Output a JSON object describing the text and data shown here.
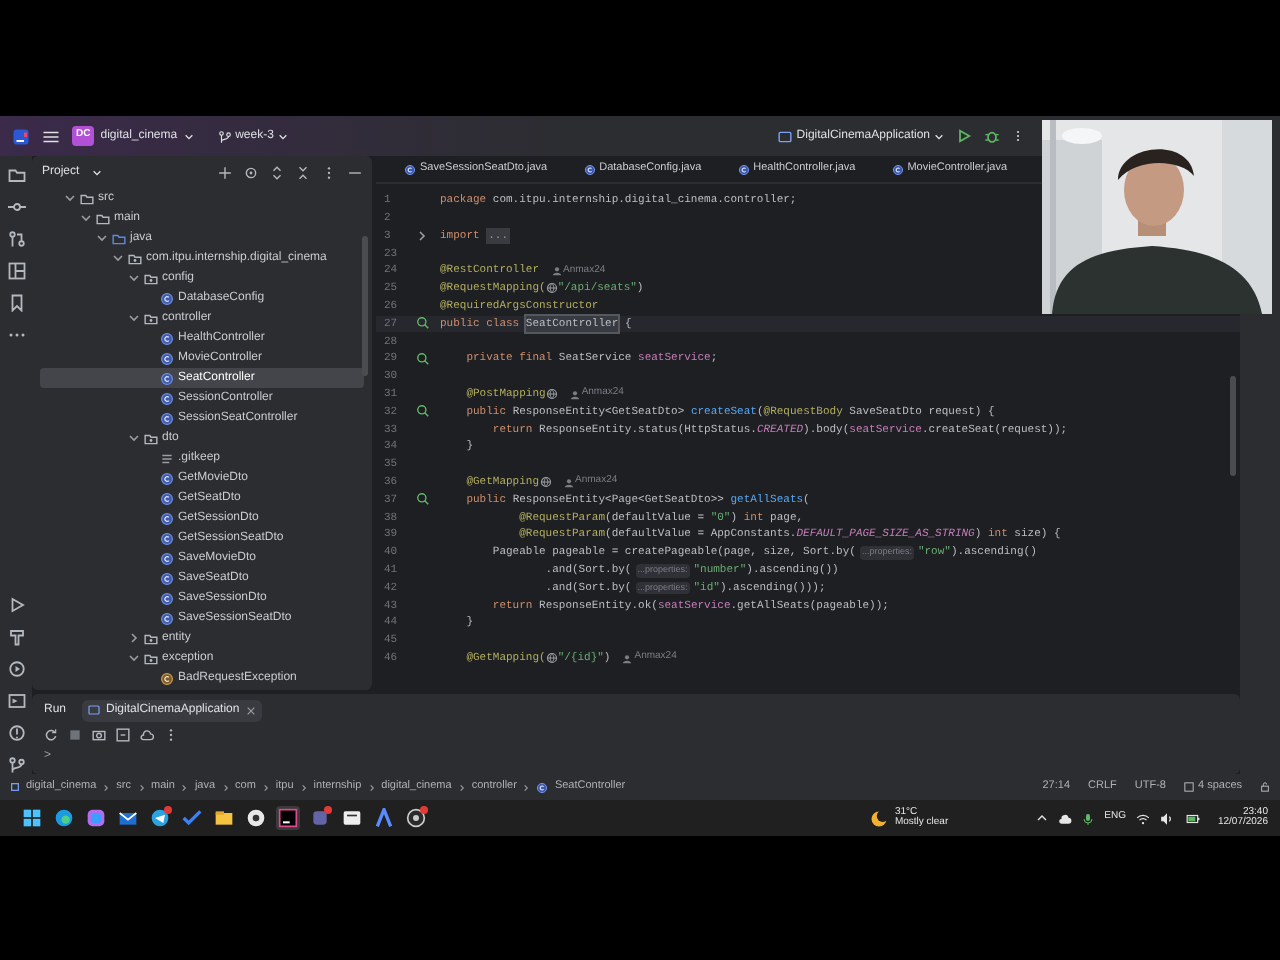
{
  "title_bar": {
    "project_badge": "DC",
    "project": "digital_cinema",
    "branch": "week-3",
    "run_config": "DigitalCinemaApplication"
  },
  "project_panel": {
    "title": "Project",
    "tree": [
      {
        "label": "src",
        "kind": "folder",
        "expanded": true,
        "selected": false,
        "children": [
          {
            "label": "main",
            "kind": "folder",
            "expanded": true,
            "selected": false,
            "children": [
              {
                "label": "java",
                "kind": "source",
                "expanded": true,
                "selected": false,
                "children": [
                  {
                    "label": "com.itpu.internship.digital_cinema",
                    "kind": "package",
                    "expanded": true,
                    "selected": false,
                    "children": [
                      {
                        "label": "config",
                        "kind": "package",
                        "expanded": true,
                        "selected": false,
                        "children": [
                          {
                            "label": "DatabaseConfig",
                            "kind": "class",
                            "selected": false
                          }
                        ]
                      },
                      {
                        "label": "controller",
                        "kind": "package",
                        "expanded": true,
                        "selected": false,
                        "children": [
                          {
                            "label": "HealthController",
                            "kind": "class",
                            "selected": false
                          },
                          {
                            "label": "MovieController",
                            "kind": "class",
                            "selected": false
                          },
                          {
                            "label": "SeatController",
                            "kind": "class",
                            "selected": true
                          },
                          {
                            "label": "SessionController",
                            "kind": "class",
                            "selected": false
                          },
                          {
                            "label": "SessionSeatController",
                            "kind": "class",
                            "selected": false
                          }
                        ]
                      },
                      {
                        "label": "dto",
                        "kind": "package",
                        "expanded": true,
                        "selected": false,
                        "children": [
                          {
                            "label": ".gitkeep",
                            "kind": "file",
                            "selected": false
                          },
                          {
                            "label": "GetMovieDto",
                            "kind": "class",
                            "selected": false
                          },
                          {
                            "label": "GetSeatDto",
                            "kind": "class",
                            "selected": false
                          },
                          {
                            "label": "GetSessionDto",
                            "kind": "class",
                            "selected": false
                          },
                          {
                            "label": "GetSessionSeatDto",
                            "kind": "class",
                            "selected": false
                          },
                          {
                            "label": "SaveMovieDto",
                            "kind": "class",
                            "selected": false
                          },
                          {
                            "label": "SaveSeatDto",
                            "kind": "class",
                            "selected": false
                          },
                          {
                            "label": "SaveSessionDto",
                            "kind": "class",
                            "selected": false
                          },
                          {
                            "label": "SaveSessionSeatDto",
                            "kind": "class",
                            "selected": false
                          }
                        ]
                      },
                      {
                        "label": "entity",
                        "kind": "package",
                        "expanded": false,
                        "selected": false
                      },
                      {
                        "label": "exception",
                        "kind": "package",
                        "expanded": true,
                        "selected": false,
                        "children": [
                          {
                            "label": "BadRequestException",
                            "kind": "exception",
                            "selected": false
                          }
                        ]
                      }
                    ]
                  }
                ]
              }
            ]
          }
        ]
      }
    ]
  },
  "editor_tabs": [
    {
      "label": "SaveSessionSeatDto.java",
      "selected": false
    },
    {
      "label": "DatabaseConfig.java",
      "selected": false
    },
    {
      "label": "HealthController.java",
      "selected": false
    },
    {
      "label": "MovieController.java",
      "selected": false
    }
  ],
  "code_lines": [
    {
      "number": "1",
      "current": false,
      "segments": [
        {
          "kind": "kw",
          "text": "package "
        },
        {
          "kind": "plain",
          "text": "com.itpu.internship.digital_cinema.controller;"
        }
      ]
    },
    {
      "number": "2",
      "current": false
    },
    {
      "number": "3",
      "current": false,
      "folded": true,
      "segments": [
        {
          "kind": "kw",
          "text": "import "
        },
        {
          "kind": "fold",
          "text": "..."
        }
      ]
    },
    {
      "number": "23",
      "current": false
    },
    {
      "number": "24",
      "current": false,
      "segments": [
        {
          "kind": "ann",
          "text": "@RestController"
        },
        {
          "kind": "author",
          "text": "Anmax24"
        }
      ]
    },
    {
      "number": "25",
      "current": false,
      "segments": [
        {
          "kind": "ann",
          "text": "@RequestMapping("
        },
        {
          "kind": "globe"
        },
        {
          "kind": "str",
          "text": "\"/api/seats\""
        },
        {
          "kind": "plain",
          "text": ")"
        }
      ]
    },
    {
      "number": "26",
      "current": false,
      "segments": [
        {
          "kind": "ann",
          "text": "@RequiredArgsConstructor"
        }
      ]
    },
    {
      "number": "27",
      "current": true,
      "marker": true,
      "segments": [
        {
          "kind": "kw",
          "text": "public class "
        },
        {
          "kind": "hl",
          "text": "SeatController"
        },
        {
          "kind": "plain",
          "text": " {"
        }
      ]
    },
    {
      "number": "28",
      "current": false
    },
    {
      "number": "29",
      "current": false,
      "marker": true,
      "segments": [
        {
          "kind": "kw",
          "text": "    private final "
        },
        {
          "kind": "plain",
          "text": "SeatService "
        },
        {
          "kind": "field",
          "text": "seatService"
        },
        {
          "kind": "plain",
          "text": ";"
        }
      ]
    },
    {
      "number": "30",
      "current": false
    },
    {
      "number": "31",
      "current": false,
      "segments": [
        {
          "kind": "ann",
          "text": "    @PostMapping"
        },
        {
          "kind": "globe"
        },
        {
          "kind": "author",
          "text": "Anmax24"
        }
      ]
    },
    {
      "number": "32",
      "current": false,
      "marker": true,
      "segments": [
        {
          "kind": "kw",
          "text": "    public "
        },
        {
          "kind": "plain",
          "text": "ResponseEntity<GetSeatDto> "
        },
        {
          "kind": "fn",
          "text": "createSeat"
        },
        {
          "kind": "plain",
          "text": "("
        },
        {
          "kind": "ann",
          "text": "@RequestBody"
        },
        {
          "kind": "plain",
          "text": " SaveSeatDto request) {"
        }
      ]
    },
    {
      "number": "33",
      "current": false,
      "segments": [
        {
          "kind": "kw",
          "text": "        return "
        },
        {
          "kind": "plain",
          "text": "ResponseEntity.status(HttpStatus."
        },
        {
          "kind": "const",
          "text": "CREATED"
        },
        {
          "kind": "plain",
          "text": ").body("
        },
        {
          "kind": "field",
          "text": "seatService"
        },
        {
          "kind": "plain",
          "text": ".createSeat(request));"
        }
      ]
    },
    {
      "number": "34",
      "current": false,
      "segments": [
        {
          "kind": "plain",
          "text": "    }"
        }
      ]
    },
    {
      "number": "35",
      "current": false
    },
    {
      "number": "36",
      "current": false,
      "segments": [
        {
          "kind": "ann",
          "text": "    @GetMapping"
        },
        {
          "kind": "globe"
        },
        {
          "kind": "author",
          "text": "Anmax24"
        }
      ]
    },
    {
      "number": "37",
      "current": false,
      "marker": true,
      "segments": [
        {
          "kind": "kw",
          "text": "    public "
        },
        {
          "kind": "plain",
          "text": "ResponseEntity<Page<GetSeatDto>> "
        },
        {
          "kind": "fn",
          "text": "getAllSeats"
        },
        {
          "kind": "plain",
          "text": "("
        }
      ]
    },
    {
      "number": "38",
      "current": false,
      "segments": [
        {
          "kind": "ann",
          "text": "            @RequestParam"
        },
        {
          "kind": "plain",
          "text": "(defaultValue = "
        },
        {
          "kind": "str",
          "text": "\"0\""
        },
        {
          "kind": "plain",
          "text": ") "
        },
        {
          "kind": "kw",
          "text": "int "
        },
        {
          "kind": "plain",
          "text": "page,"
        }
      ]
    },
    {
      "number": "39",
      "current": false,
      "segments": [
        {
          "kind": "ann",
          "text": "            @RequestParam"
        },
        {
          "kind": "plain",
          "text": "(defaultValue = AppConstants."
        },
        {
          "kind": "const",
          "text": "DEFAULT_PAGE_SIZE_AS_STRING"
        },
        {
          "kind": "plain",
          "text": ") "
        },
        {
          "kind": "kw",
          "text": "int "
        },
        {
          "kind": "plain",
          "text": "size) {"
        }
      ]
    },
    {
      "number": "40",
      "current": false,
      "segments": [
        {
          "kind": "plain",
          "text": "        Pageable pageable = createPageable(page, size, Sort.by("
        },
        {
          "kind": "hint",
          "text": "...properties:"
        },
        {
          "kind": "str",
          "text": "\"row\""
        },
        {
          "kind": "plain",
          "text": ").ascending()"
        }
      ]
    },
    {
      "number": "41",
      "current": false,
      "segments": [
        {
          "kind": "plain",
          "text": "                .and(Sort.by("
        },
        {
          "kind": "hint",
          "text": "...properties:"
        },
        {
          "kind": "str",
          "text": "\"number\""
        },
        {
          "kind": "plain",
          "text": ").ascending())"
        }
      ]
    },
    {
      "number": "42",
      "current": false,
      "segments": [
        {
          "kind": "plain",
          "text": "                .and(Sort.by("
        },
        {
          "kind": "hint",
          "text": "...properties:"
        },
        {
          "kind": "str",
          "text": "\"id\""
        },
        {
          "kind": "plain",
          "text": ").ascending()));"
        }
      ]
    },
    {
      "number": "43",
      "current": false,
      "segments": [
        {
          "kind": "kw",
          "text": "        return "
        },
        {
          "kind": "plain",
          "text": "ResponseEntity.ok("
        },
        {
          "kind": "field",
          "text": "seatService"
        },
        {
          "kind": "plain",
          "text": ".getAllSeats(pageable));"
        }
      ]
    },
    {
      "number": "44",
      "current": false,
      "segments": [
        {
          "kind": "plain",
          "text": "    }"
        }
      ]
    },
    {
      "number": "45",
      "current": false
    },
    {
      "number": "46",
      "current": false,
      "segments": [
        {
          "kind": "ann",
          "text": "    @GetMapping("
        },
        {
          "kind": "globe"
        },
        {
          "kind": "str",
          "text": "\"/{id}\""
        },
        {
          "kind": "plain",
          "text": ")"
        },
        {
          "kind": "author",
          "text": "Anmax24"
        }
      ]
    }
  ],
  "run_panel": {
    "title": "Run",
    "tab": "DigitalCinemaApplication",
    "prompt": ">"
  },
  "status_bar": {
    "breadcrumbs": [
      "digital_cinema",
      "src",
      "main",
      "java",
      "com",
      "itpu",
      "internship",
      "digital_cinema",
      "controller",
      "SeatController"
    ],
    "position": "27:14",
    "line_ending": "CRLF",
    "encoding": "UTF-8",
    "indent": "4 spaces"
  },
  "taskbar": {
    "apps": [
      {
        "kind": "start",
        "active": false,
        "badge": false
      },
      {
        "kind": "edge",
        "active": false,
        "badge": false
      },
      {
        "kind": "copilot",
        "active": false,
        "badge": false
      },
      {
        "kind": "mail",
        "active": false,
        "badge": false
      },
      {
        "kind": "telegram",
        "active": false,
        "badge": true
      },
      {
        "kind": "todo",
        "active": false,
        "badge": false
      },
      {
        "kind": "explorer",
        "active": false,
        "badge": false
      },
      {
        "kind": "chrome",
        "active": false,
        "badge": false
      },
      {
        "kind": "intellij",
        "active": true,
        "badge": false
      },
      {
        "kind": "teams",
        "active": false,
        "badge": true
      },
      {
        "kind": "terminal",
        "active": false,
        "badge": false
      },
      {
        "kind": "arc",
        "active": false,
        "badge": false
      },
      {
        "kind": "obs",
        "active": false,
        "badge": true
      }
    ],
    "weather": {
      "temp": "31°C",
      "condition": "Mostly clear"
    },
    "language": "ENG",
    "time": "23:40",
    "date": "12/07/2026"
  }
}
